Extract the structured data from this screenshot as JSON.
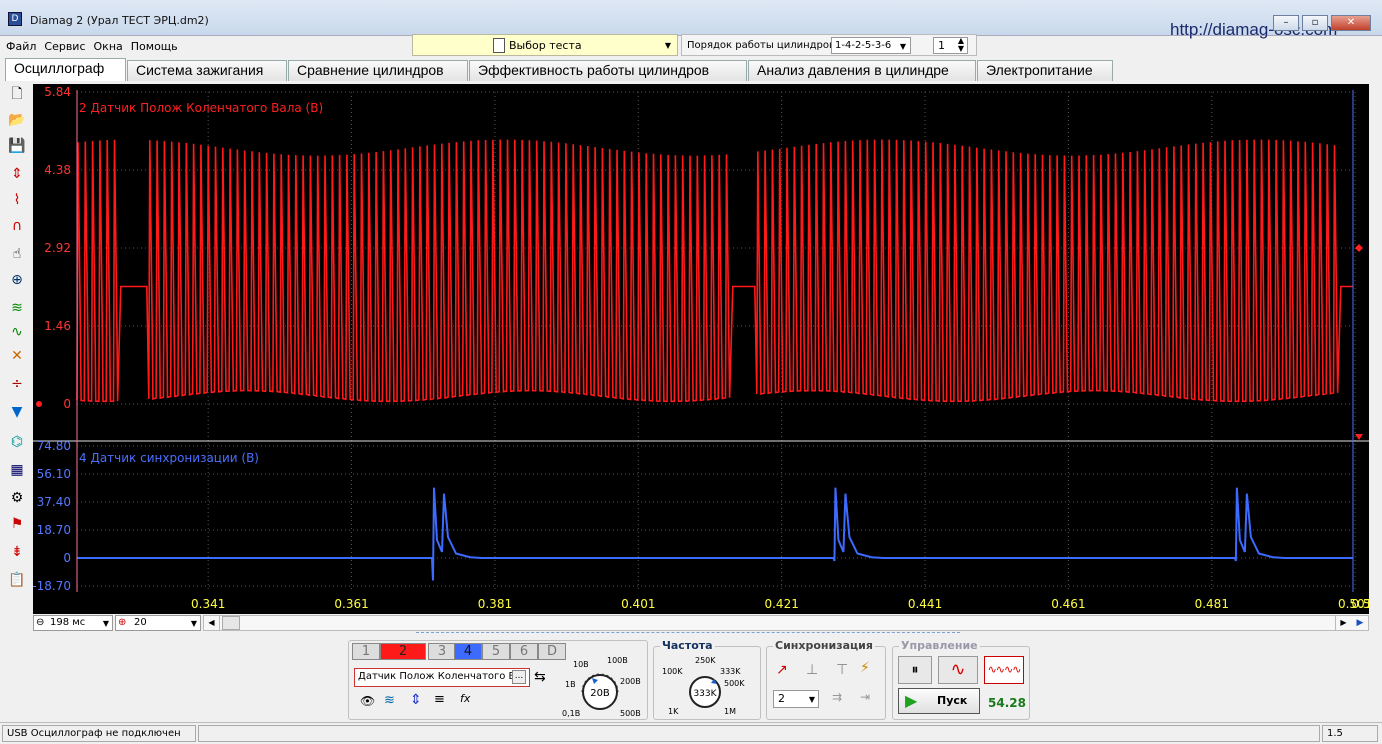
{
  "window": {
    "title": "Diamag 2 (Урал ТЕСТ ЭРЦ.dm2)",
    "url": "http://diamag-osc.com",
    "icon_letter": "D"
  },
  "menu": {
    "items": [
      "Файл",
      "Сервис",
      "Окна",
      "Помощь"
    ]
  },
  "test_select": {
    "label": "Выбор теста"
  },
  "cylinder_order": {
    "label": "Порядок работы цилиндров",
    "value": "1-4-2-5-3-6",
    "count": "1"
  },
  "tabs": [
    "Осциллограф",
    "Система зажигания",
    "Сравнение цилиндров",
    "Эффективность работы цилиндров",
    "Анализ давления в цилиндре",
    "Электропитание"
  ],
  "toolbar_icons": [
    "new-file-icon",
    "open-folder-icon",
    "save-icon",
    "auto-scale-icon",
    "cursor-measure-icon",
    "cursor-peak-icon",
    "hand-pan-icon",
    "zoom-icon",
    "filter-icon",
    "sine-icon",
    "cross-icon",
    "split-icon",
    "channel-filter-icon",
    "spectrum-icon",
    "table-icon",
    "auto-settings-icon",
    "marker-flag-icon",
    "zero-offset-icon",
    "notes-icon"
  ],
  "channel_top": {
    "label": "2 Датчик Полож Коленчатого Вала (В)",
    "color": "#ff1a1a",
    "ticks": [
      "5.84",
      "4.38",
      "2.92",
      "1.46",
      "0"
    ]
  },
  "channel_bottom": {
    "label": "4 Датчик синхронизации (В)",
    "color": "#3d6bff",
    "ticks": [
      "74.80",
      "56.10",
      "37.40",
      "18.70",
      "0",
      "-18.70"
    ]
  },
  "time_axis": {
    "ticks": [
      "0.341",
      "0.361",
      "0.381",
      "0.401",
      "0.421",
      "0.441",
      "0.461",
      "0.481",
      "0.501",
      "0.5"
    ]
  },
  "chart_data": {
    "type": "line",
    "series": [
      {
        "name": "2 Датчик Полож Коленчатого Вала (В)",
        "gaps_at": [
          0.3305,
          0.4155,
          0.5005
        ],
        "amplitude_range": [
          0.1,
          4.9
        ]
      },
      {
        "name": "4 Датчик синхронизации (В)",
        "pulses_at": [
          0.3725,
          0.4285,
          0.4845
        ],
        "peak": 47
      }
    ]
  },
  "timebase": {
    "value": "198 мс",
    "zoom": "20"
  },
  "channels": {
    "buttons": [
      "1",
      "2",
      "3",
      "4",
      "5",
      "6",
      "D"
    ],
    "selected_name": "Датчик Полож Коленчатого Ва",
    "more": "..."
  },
  "voltage_knob": {
    "value": "20В",
    "labels": [
      "10В",
      "100В",
      "1В",
      "200В",
      "0,1В",
      "500В"
    ]
  },
  "frequency": {
    "title": "Частота",
    "value": "333K",
    "labels": [
      "250K",
      "100K",
      "333K",
      "500K",
      "1K",
      "1M"
    ]
  },
  "sync": {
    "title": "Синхронизация",
    "channel": "2"
  },
  "control": {
    "title": "Управление",
    "start_label": "Пуск",
    "value": "54.28"
  },
  "status": {
    "message": "USB Осциллограф не подключен",
    "right": "1.5"
  }
}
